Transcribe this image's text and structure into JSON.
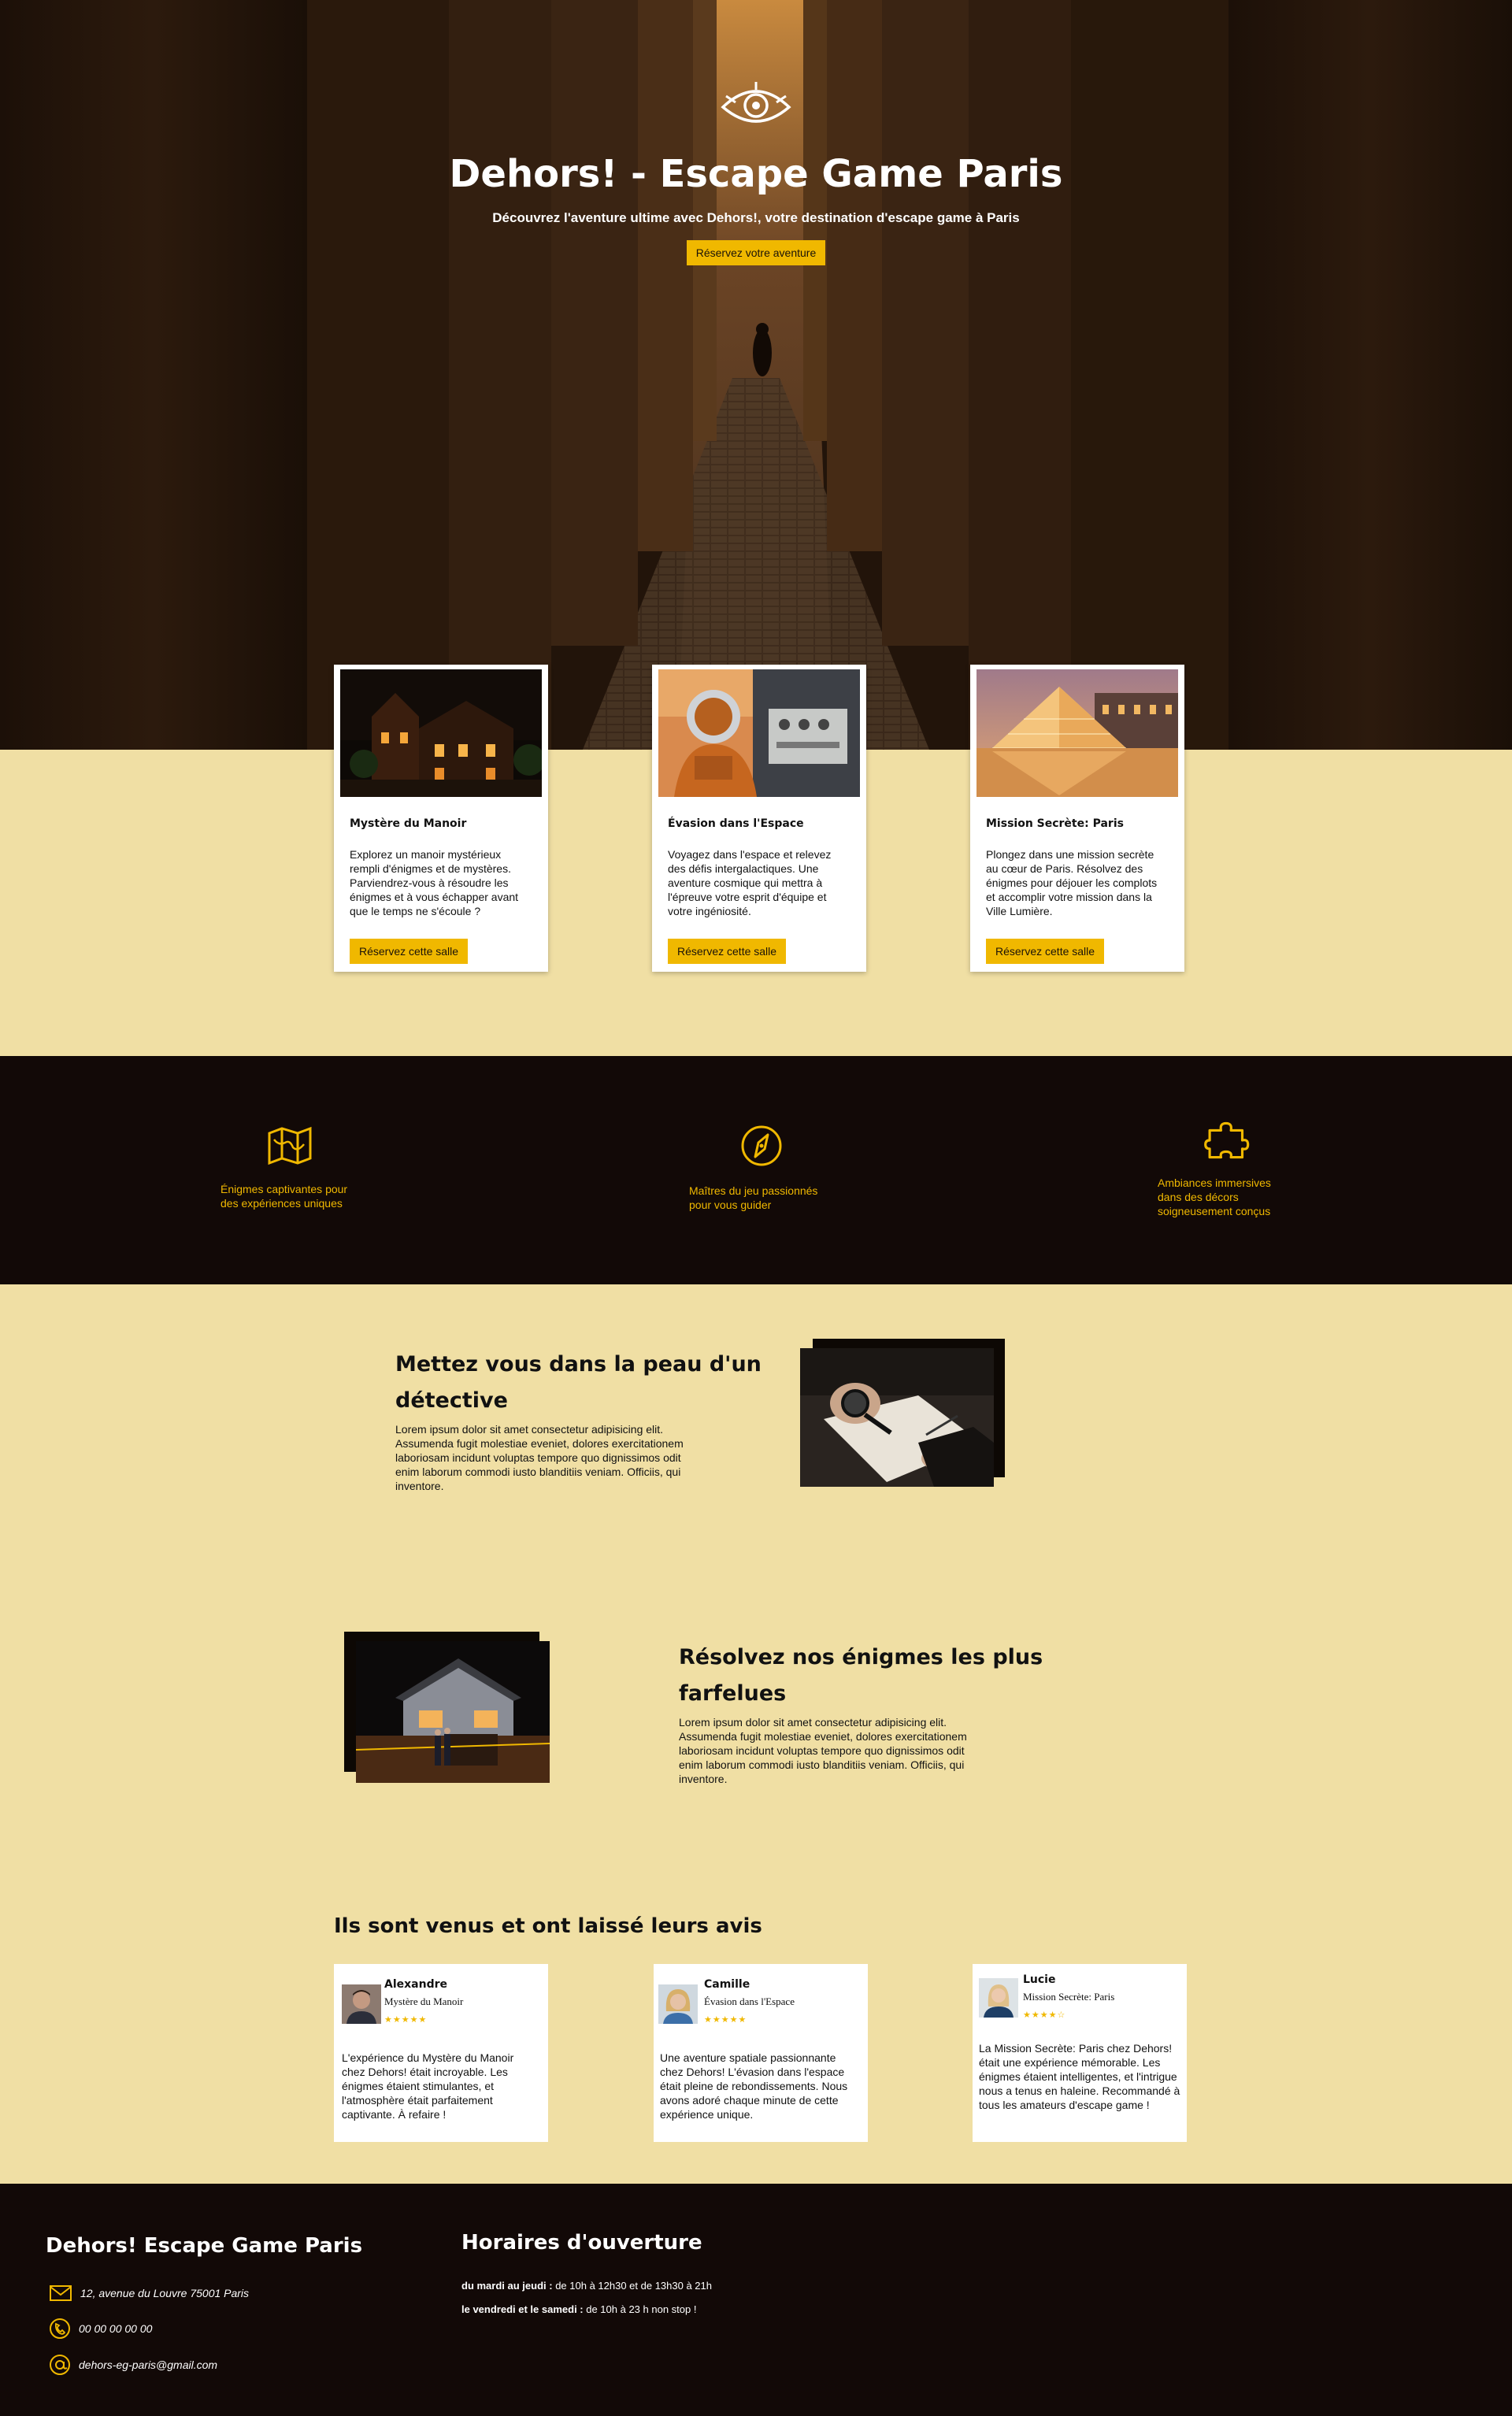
{
  "hero": {
    "title": "Dehors! - Escape Game Paris",
    "subtitle": "Découvrez l'aventure ultime avec Dehors!, votre destination d'escape game à Paris",
    "cta_label": "Réservez votre aventure"
  },
  "rooms": [
    {
      "title": "Mystère du Manoir",
      "description": "Explorez un manoir mystérieux rempli d'énigmes et de mystères. Parviendrez-vous à résoudre les énigmes et à vous échapper avant que le temps ne s'écoule ?",
      "button_label": "Réservez cette salle"
    },
    {
      "title": "Évasion dans l'Espace",
      "description": "Voyagez dans l'espace et relevez des défis intergalactiques. Une aventure cosmique qui mettra à l'épreuve votre esprit d'équipe et votre ingéniosité.",
      "button_label": "Réservez cette salle"
    },
    {
      "title": "Mission Secrète: Paris",
      "description": "Plongez dans une mission secrète au cœur de Paris. Résolvez des énigmes pour déjouer les complots et accomplir votre mission dans la Ville Lumière.",
      "button_label": "Réservez cette salle"
    }
  ],
  "features": [
    {
      "icon": "map-icon",
      "text_line1": "Énigmes captivantes pour",
      "text_line2": "des expériences uniques"
    },
    {
      "icon": "compass-icon",
      "text_line1": "Maîtres du jeu passionnés",
      "text_line2": "pour vous guider"
    },
    {
      "icon": "puzzle-icon",
      "text_line1": "Ambiances immersives",
      "text_line2": "dans des décors",
      "text_line3": "soigneusement conçus"
    }
  ],
  "stories": [
    {
      "title_line1": "Mettez vous dans la peau d'un",
      "title_line2": "détective",
      "text": "Lorem ipsum dolor sit amet consectetur adipisicing elit. Assumenda fugit molestiae eveniet, dolores exercitationem laboriosam incidunt voluptas tempore quo dignissimos odit enim laborum commodi iusto blanditiis veniam. Officiis, qui inventore."
    },
    {
      "title_line1": "Résolvez nos énigmes les plus",
      "title_line2": "farfelues",
      "text": "Lorem ipsum dolor sit amet consectetur adipisicing elit. Assumenda fugit molestiae eveniet, dolores exercitationem laboriosam incidunt voluptas tempore quo dignissimos odit enim laborum commodi iusto blanditiis veniam. Officiis, qui inventore."
    }
  ],
  "reviews": {
    "title": "Ils sont venus et ont laissé leurs avis",
    "items": [
      {
        "name": "Alexandre",
        "room": "Mystère du Manoir",
        "stars": "★★★★★",
        "text": "L'expérience du Mystère du Manoir chez Dehors! était incroyable. Les énigmes étaient stimulantes, et l'atmosphère était parfaitement captivante. À refaire !"
      },
      {
        "name": "Camille",
        "room": "Évasion dans l'Espace",
        "stars": "★★★★★",
        "text": "Une aventure spatiale passionnante chez Dehors! L'évasion dans l'espace était pleine de rebondissements. Nous avons adoré chaque minute de cette expérience unique."
      },
      {
        "name": "Lucie",
        "room": "Mission Secrète: Paris",
        "stars": "★★★★☆",
        "text": "La Mission Secrète: Paris chez Dehors! était une expérience mémorable. Les énigmes étaient intelligentes, et l'intrigue nous a tenus en haleine. Recommandé à tous les amateurs d'escape game !"
      }
    ]
  },
  "footer": {
    "brand": "Dehors! Escape Game Paris",
    "address": "12, avenue du Louvre 75001 Paris",
    "phone": "00 00 00 00 00",
    "email": "dehors-eg-paris@gmail.com",
    "hours_title": "Horaires d'ouverture",
    "hours": [
      {
        "days": "du mardi au jeudi :",
        "times": " de 10h à 12h30 et de 13h30 à 21h"
      },
      {
        "days": "le vendredi et le samedi :",
        "times": " de 10h à 23 h non stop !"
      }
    ]
  },
  "colors": {
    "accent": "#f0b800",
    "sand_background": "#f0dfa4",
    "dark_background": "#120907"
  }
}
